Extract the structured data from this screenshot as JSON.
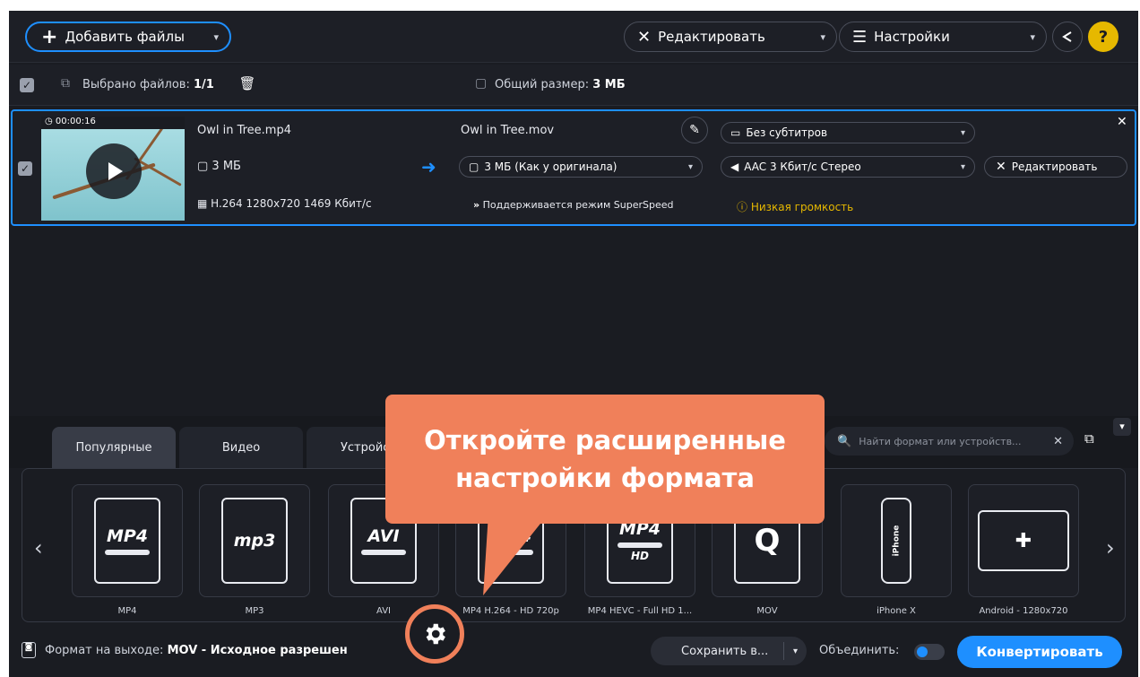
{
  "toolbar": {
    "add_files": "Добавить файлы",
    "edit": "Редактировать",
    "settings": "Настройки",
    "help": "?"
  },
  "selection": {
    "selected_label": "Выбрано файлов:",
    "selected_count": "1/1",
    "total_size_label": "Общий размер:",
    "total_size_value": "3 МБ"
  },
  "file": {
    "duration": "00:00:16",
    "name": "Owl in Tree.mp4",
    "size": "3 МБ",
    "codec": "H.264 1280x720 1469 Кбит/с",
    "output_name": "Owl in Tree.mov",
    "output_size": "3 МБ (Как у оригинала)",
    "superspeed": "Поддерживается режим SuperSpeed",
    "subtitles": "Без субтитров",
    "audio": "AAC 3 Кбит/с Стерео",
    "low_volume": "Низкая громкость",
    "edit": "Редактировать"
  },
  "tabs": [
    "Популярные",
    "Видео",
    "Устройст"
  ],
  "search": {
    "placeholder": "Найти формат или устройств..."
  },
  "formats": [
    {
      "label": "MP4",
      "icon": "MP4"
    },
    {
      "label": "MP3",
      "icon": "mp3"
    },
    {
      "label": "AVI",
      "icon": "AVI"
    },
    {
      "label": "MP4 H.264 - HD 720p",
      "icon": "MP4"
    },
    {
      "label": "MP4 HEVC - Full HD 1...",
      "icon": "MP4"
    },
    {
      "label": "MOV",
      "icon": "Q"
    },
    {
      "label": "iPhone X",
      "icon": "iPhone"
    },
    {
      "label": "Android - 1280x720",
      "icon": "android"
    }
  ],
  "bottom": {
    "output_label": "Формат на выходе:",
    "output_value": "MOV - Исходное разрешен",
    "save": "Сохранить в...",
    "merge": "Объединить:",
    "convert": "Конвертировать"
  },
  "callout": {
    "line1": "Откройте расширенные",
    "line2": "настройки формата"
  },
  "colors": {
    "accent": "#1e8fff",
    "callout": "#f0805a",
    "warning": "#e6b800",
    "background": "#1a1c22"
  }
}
